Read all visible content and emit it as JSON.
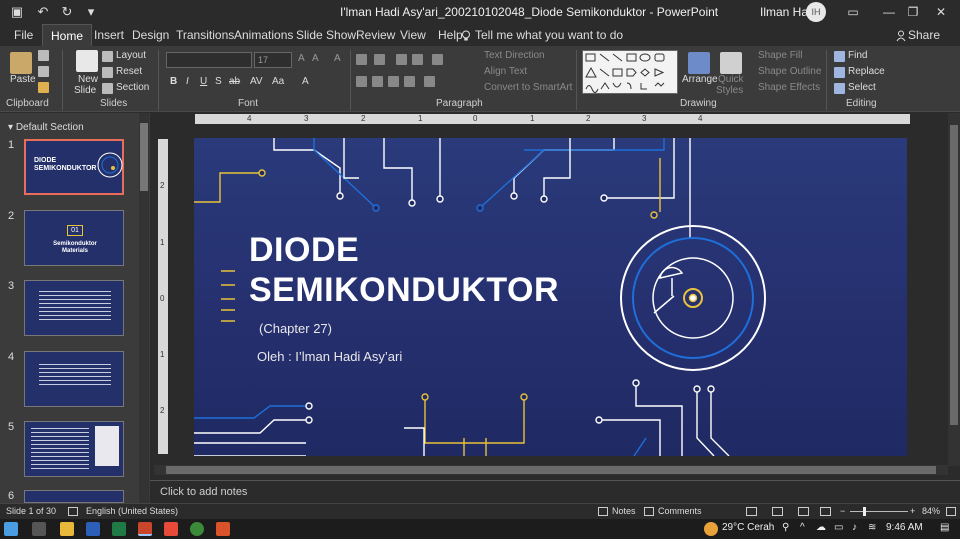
{
  "titlebar": {
    "doc_title": "I'lman Hadi Asy'ari_200210102048_Diode Semikonduktor  -  PowerPoint",
    "user_name": "Ilman Had",
    "user_initials": "IH",
    "undo_glyph": "↶",
    "redo_glyph": "↻",
    "save_glyph": "▣",
    "customize_glyph": "▾",
    "ribbon_opts_glyph": "▭",
    "minimize_glyph": "—",
    "restore_glyph": "❐",
    "close_glyph": "✕"
  },
  "tabs": [
    "File",
    "Home",
    "Insert",
    "Design",
    "Transitions",
    "Animations",
    "Slide Show",
    "Review",
    "View",
    "Help"
  ],
  "active_tab": "Home",
  "tell_me": "Tell me what you want to do",
  "share": "Share",
  "ribbon": {
    "clipboard": {
      "label": "Clipboard",
      "paste": "Paste"
    },
    "slides": {
      "label": "Slides",
      "new_slide": "New",
      "new_slide2": "Slide",
      "layout": "Layout",
      "reset": "Reset",
      "section": "Section"
    },
    "font": {
      "label": "Font",
      "size": "17",
      "bold": "B",
      "italic": "I",
      "underline": "U",
      "strike": "S",
      "shadow": "ab",
      "spacing": "AV",
      "case": "Aa",
      "color": "A"
    },
    "paragraph": {
      "label": "Paragraph",
      "text_direction": "Text Direction",
      "align_text": "Align Text",
      "convert": "Convert to SmartArt"
    },
    "drawing": {
      "label": "Drawing",
      "arrange": "Arrange",
      "quick": "Quick",
      "styles": "Styles",
      "shape_fill": "Shape Fill",
      "shape_outline": "Shape Outline",
      "shape_effects": "Shape Effects"
    },
    "editing": {
      "label": "Editing",
      "find": "Find",
      "replace": "Replace",
      "select": "Select"
    }
  },
  "thumbs": {
    "section": "Default Section",
    "numbers": [
      "1",
      "2",
      "3",
      "4",
      "5",
      "6"
    ],
    "t1_title": "DIODE SEMIKONDUKTOR",
    "t2_num": "01",
    "t2_title": "Semikonduktor Materials"
  },
  "ruler_h": [
    "4",
    "3",
    "2",
    "1",
    "0",
    "1",
    "2",
    "3",
    "4"
  ],
  "ruler_v": [
    "2",
    "1",
    "0",
    "1",
    "2"
  ],
  "slide": {
    "title_line1": "DIODE",
    "title_line2": "SEMIKONDUKTOR",
    "chapter": "(Chapter 27)",
    "author": "Oleh : I’lman Hadi Asy’ari"
  },
  "notes_placeholder": "Click to add notes",
  "status": {
    "slide_info": "Slide 1 of 30",
    "language": "English (United States)",
    "notes": "Notes",
    "comments": "Comments",
    "zoom": "84%"
  },
  "taskbar": {
    "weather": "29°C  Cerah",
    "time": "9:46 AM"
  },
  "colors": {
    "slide_bg": "#252f6e",
    "accent_yellow": "#e9c23a",
    "accent_blue": "#1e6fd9",
    "line_white": "#ffffff",
    "selected_thumb": "#e86e5a"
  }
}
